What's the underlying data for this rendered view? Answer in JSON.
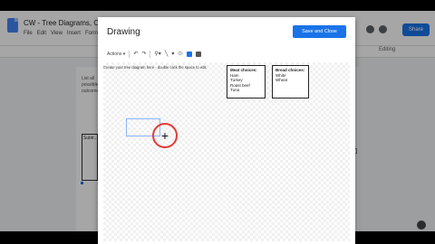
{
  "docs": {
    "title": "CW - Tree Diagrams, Orga...",
    "menu": [
      "File",
      "Edit",
      "View",
      "Insert",
      "Format"
    ],
    "share_label": "Share",
    "editing_label": "Editing",
    "page_text": "List all possible outcomes",
    "sidebox_text": "Subtr..."
  },
  "dialog": {
    "title": "Drawing",
    "save_label": "Save and Close",
    "toolbar": {
      "actions_label": "Actions",
      "undo_icon": "↶",
      "redo_icon": "↷",
      "zoom_icon": "🔍",
      "line_icon": "╲",
      "shape_icon": "⬭"
    },
    "canvas_hint": "Create your tree diagram here - double click the space to edit",
    "meat_box": {
      "header": "Meat choices:",
      "items": [
        "Ham",
        "Turkey",
        "Roast beef",
        "Tuna"
      ]
    },
    "bread_box": {
      "header": "Bread choices:",
      "items": [
        "White",
        "Wheat"
      ]
    },
    "cursor_symbol": "+"
  },
  "colors": {
    "accent": "#1a73e8",
    "cursor_ring": "#e53935"
  }
}
